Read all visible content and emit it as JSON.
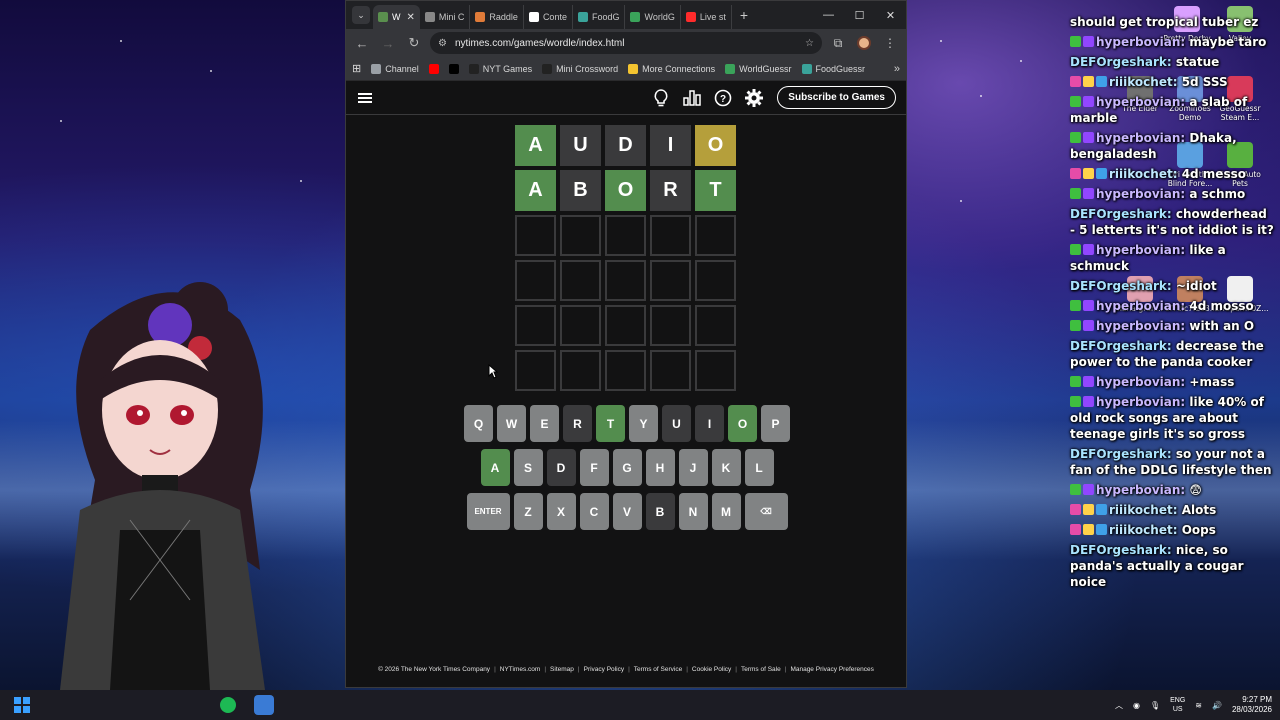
{
  "browser": {
    "tabs": [
      {
        "label": "W",
        "color": "#5a8f4e",
        "active": true
      },
      {
        "label": "Mini C",
        "color": "#888888"
      },
      {
        "label": "Raddle",
        "color": "#e07b39"
      },
      {
        "label": "Conte",
        "color": "#ffffff"
      },
      {
        "label": "FoodG",
        "color": "#3aa39a"
      },
      {
        "label": "WorldG",
        "color": "#3aa35a"
      },
      {
        "label": "Live st",
        "color": "#ff2b2b"
      }
    ],
    "url": "nytimes.com/games/wordle/index.html",
    "bookmarks": [
      {
        "label": "Channel",
        "color": "#9aa0a6"
      },
      {
        "label": "",
        "color": "#ff0000"
      },
      {
        "label": "",
        "color": "#000000"
      },
      {
        "label": "NYT Games",
        "color": "#222222"
      },
      {
        "label": "Mini Crossword",
        "color": "#222222"
      },
      {
        "label": "More Connections",
        "color": "#f4c430"
      },
      {
        "label": "WorldGuessr",
        "color": "#3aa35a"
      },
      {
        "label": "FoodGuessr",
        "color": "#3aa39a"
      }
    ]
  },
  "wordle": {
    "subscribe_label": "Subscribe to Games",
    "board": [
      [
        {
          "l": "A",
          "s": "correct"
        },
        {
          "l": "U",
          "s": "absent"
        },
        {
          "l": "D",
          "s": "absent"
        },
        {
          "l": "I",
          "s": "absent"
        },
        {
          "l": "O",
          "s": "present"
        }
      ],
      [
        {
          "l": "A",
          "s": "correct"
        },
        {
          "l": "B",
          "s": "absent"
        },
        {
          "l": "O",
          "s": "correct"
        },
        {
          "l": "R",
          "s": "absent"
        },
        {
          "l": "T",
          "s": "correct"
        }
      ],
      [
        {
          "l": "",
          "s": "empty"
        },
        {
          "l": "",
          "s": "empty"
        },
        {
          "l": "",
          "s": "empty"
        },
        {
          "l": "",
          "s": "empty"
        },
        {
          "l": "",
          "s": "empty"
        }
      ],
      [
        {
          "l": "",
          "s": "empty"
        },
        {
          "l": "",
          "s": "empty"
        },
        {
          "l": "",
          "s": "empty"
        },
        {
          "l": "",
          "s": "empty"
        },
        {
          "l": "",
          "s": "empty"
        }
      ],
      [
        {
          "l": "",
          "s": "empty"
        },
        {
          "l": "",
          "s": "empty"
        },
        {
          "l": "",
          "s": "empty"
        },
        {
          "l": "",
          "s": "empty"
        },
        {
          "l": "",
          "s": "empty"
        }
      ],
      [
        {
          "l": "",
          "s": "empty"
        },
        {
          "l": "",
          "s": "empty"
        },
        {
          "l": "",
          "s": "empty"
        },
        {
          "l": "",
          "s": "empty"
        },
        {
          "l": "",
          "s": "empty"
        }
      ]
    ],
    "keyboard": [
      [
        {
          "k": "Q",
          "s": "unused"
        },
        {
          "k": "W",
          "s": "unused"
        },
        {
          "k": "E",
          "s": "unused"
        },
        {
          "k": "R",
          "s": "absent"
        },
        {
          "k": "T",
          "s": "correct"
        },
        {
          "k": "Y",
          "s": "unused"
        },
        {
          "k": "U",
          "s": "absent"
        },
        {
          "k": "I",
          "s": "absent"
        },
        {
          "k": "O",
          "s": "correct"
        },
        {
          "k": "P",
          "s": "unused"
        }
      ],
      [
        {
          "k": "A",
          "s": "correct"
        },
        {
          "k": "S",
          "s": "unused"
        },
        {
          "k": "D",
          "s": "absent"
        },
        {
          "k": "F",
          "s": "unused"
        },
        {
          "k": "G",
          "s": "unused"
        },
        {
          "k": "H",
          "s": "unused"
        },
        {
          "k": "J",
          "s": "unused"
        },
        {
          "k": "K",
          "s": "unused"
        },
        {
          "k": "L",
          "s": "unused"
        }
      ],
      [
        {
          "k": "ENTER",
          "s": "unused",
          "wide": true
        },
        {
          "k": "Z",
          "s": "unused"
        },
        {
          "k": "X",
          "s": "unused"
        },
        {
          "k": "C",
          "s": "unused"
        },
        {
          "k": "V",
          "s": "unused"
        },
        {
          "k": "B",
          "s": "absent"
        },
        {
          "k": "N",
          "s": "unused"
        },
        {
          "k": "M",
          "s": "unused"
        },
        {
          "k": "⌫",
          "s": "unused",
          "wide": true
        }
      ]
    ],
    "footer": [
      "© 2026 The New York Times Company",
      "NYTimes.com",
      "Sitemap",
      "Privacy Policy",
      "Terms of Service",
      "Cookie Policy",
      "Terms of Sale",
      "Manage Privacy Preferences"
    ]
  },
  "chat": [
    {
      "user": "",
      "badges": [],
      "text": "should get tropical tuber ez"
    },
    {
      "user": "hyperbovian",
      "badges": [
        "#3fbf3f",
        "#9146ff"
      ],
      "text": "maybe taro"
    },
    {
      "user": "DEFOrgeshark",
      "badges": [],
      "text": "statue"
    },
    {
      "user": "riiikochet",
      "badges": [
        "#e64ca8",
        "#ffd24a",
        "#3fa0e8"
      ],
      "text": "5d SSS"
    },
    {
      "user": "hyperbovian",
      "badges": [
        "#3fbf3f",
        "#9146ff"
      ],
      "text": "a slab of marble"
    },
    {
      "user": "hyperbovian",
      "badges": [
        "#3fbf3f",
        "#9146ff"
      ],
      "text": "Dhaka, bengaladesh"
    },
    {
      "user": "riiikochet",
      "badges": [
        "#e64ca8",
        "#ffd24a",
        "#3fa0e8"
      ],
      "text": "4d messo"
    },
    {
      "user": "hyperbovian",
      "badges": [
        "#3fbf3f",
        "#9146ff"
      ],
      "text": "a schmo"
    },
    {
      "user": "DEFOrgeshark",
      "badges": [],
      "text": "chowderhead - 5 letterts it's not iddiot is it?"
    },
    {
      "user": "hyperbovian",
      "badges": [
        "#3fbf3f",
        "#9146ff"
      ],
      "text": "like a schmuck"
    },
    {
      "user": "DEFOrgeshark",
      "badges": [],
      "text": "~idiot"
    },
    {
      "user": "hyperbovian",
      "badges": [
        "#3fbf3f",
        "#9146ff"
      ],
      "text": "4d mosso"
    },
    {
      "user": "hyperbovian",
      "badges": [
        "#3fbf3f",
        "#9146ff"
      ],
      "text": "with an O"
    },
    {
      "user": "DEFOrgeshark",
      "badges": [],
      "text": "decrease the power to the panda cooker"
    },
    {
      "user": "hyperbovian",
      "badges": [
        "#3fbf3f",
        "#9146ff"
      ],
      "text": "+mass"
    },
    {
      "user": "hyperbovian",
      "badges": [
        "#3fbf3f",
        "#9146ff"
      ],
      "text": "like 40% of old rock songs are about teenage girls it's so gross"
    },
    {
      "user": "DEFOrgeshark",
      "badges": [],
      "text": "so your not a fan of the DDLG lifestyle then"
    },
    {
      "user": "hyperbovian",
      "badges": [
        "#3fbf3f",
        "#9146ff"
      ],
      "text": "😨"
    },
    {
      "user": "riiikochet",
      "badges": [
        "#e64ca8",
        "#ffd24a",
        "#3fa0e8"
      ],
      "text": "Alots"
    },
    {
      "user": "riiikochet",
      "badges": [
        "#e64ca8",
        "#ffd24a",
        "#3fa0e8"
      ],
      "text": "Oops"
    },
    {
      "user": "DEFOrgeshark",
      "badges": [],
      "text": "nice, so panda's actually a cougar noice"
    }
  ],
  "desktop_icons": [
    {
      "label": "Pretty Derby",
      "color": "#d9a0ff"
    },
    {
      "label": "Valley",
      "color": "#88c070"
    },
    {
      "label": "The Elder",
      "color": "#707070"
    },
    {
      "label": "Zoominoes Demo",
      "color": "#6a8fd8"
    },
    {
      "label": "GeoGuessr Steam E...",
      "color": "#d83a5a"
    },
    {
      "label": "Ori and the Blind Fore...",
      "color": "#5aa0e0"
    },
    {
      "label": "Super Auto Pets",
      "color": "#58b040"
    },
    {
      "label": "hana-gran...",
      "color": "#e0a0b0"
    },
    {
      "label": "0f7cfc7f263...",
      "color": "#c08060"
    },
    {
      "label": "cHUpdmF0Z...",
      "color": "#f0f0f0"
    }
  ],
  "taskbar": {
    "lang_top": "ENG",
    "lang_bottom": "US",
    "time": "9:27 PM",
    "date": "28/03/2026"
  }
}
